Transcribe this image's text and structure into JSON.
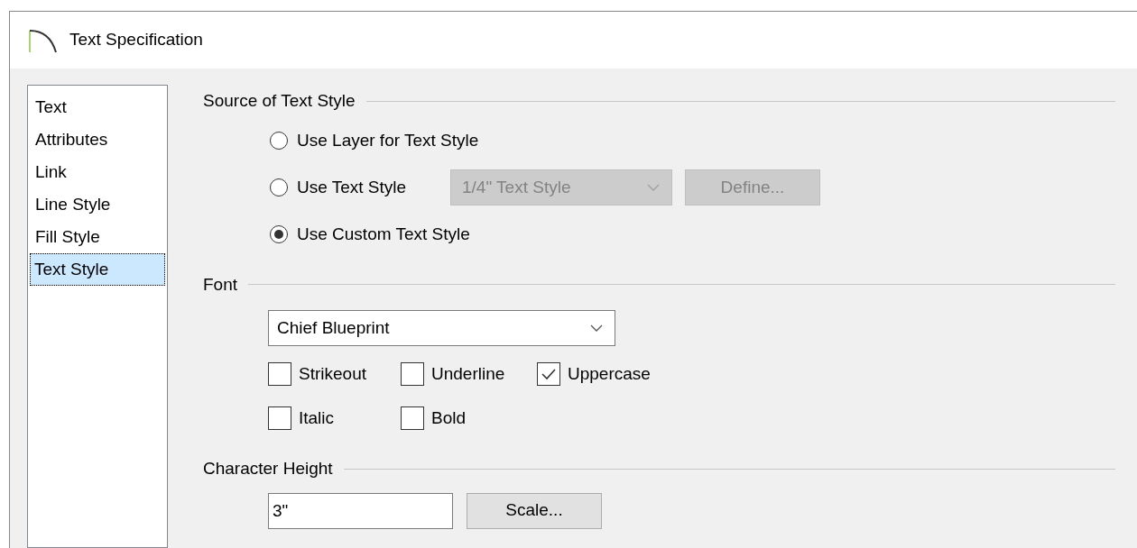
{
  "window": {
    "title": "Text Specification"
  },
  "sidebar": {
    "items": [
      {
        "label": "Text",
        "selected": false
      },
      {
        "label": "Attributes",
        "selected": false
      },
      {
        "label": "Link",
        "selected": false
      },
      {
        "label": "Line Style",
        "selected": false
      },
      {
        "label": "Fill Style",
        "selected": false
      },
      {
        "label": "Text Style",
        "selected": true
      }
    ]
  },
  "source_section": {
    "title": "Source of Text Style",
    "options": [
      {
        "label": "Use Layer for Text Style",
        "selected": false
      },
      {
        "label": "Use Text Style",
        "selected": false,
        "dropdown": {
          "value": "1/4\" Text Style",
          "disabled": true
        },
        "button": {
          "label": "Define...",
          "disabled": true
        }
      },
      {
        "label": "Use Custom Text Style",
        "selected": true
      }
    ]
  },
  "font_section": {
    "title": "Font",
    "dropdown": {
      "value": "Chief Blueprint"
    },
    "checkbox_rows": [
      [
        {
          "label": "Strikeout",
          "checked": false
        },
        {
          "label": "Underline",
          "checked": false
        },
        {
          "label": "Uppercase",
          "checked": true
        }
      ],
      [
        {
          "label": "Italic",
          "checked": false
        },
        {
          "label": "Bold",
          "checked": false
        }
      ]
    ]
  },
  "height_section": {
    "title": "Character Height",
    "value": "3\"",
    "button": {
      "label": "Scale..."
    }
  }
}
